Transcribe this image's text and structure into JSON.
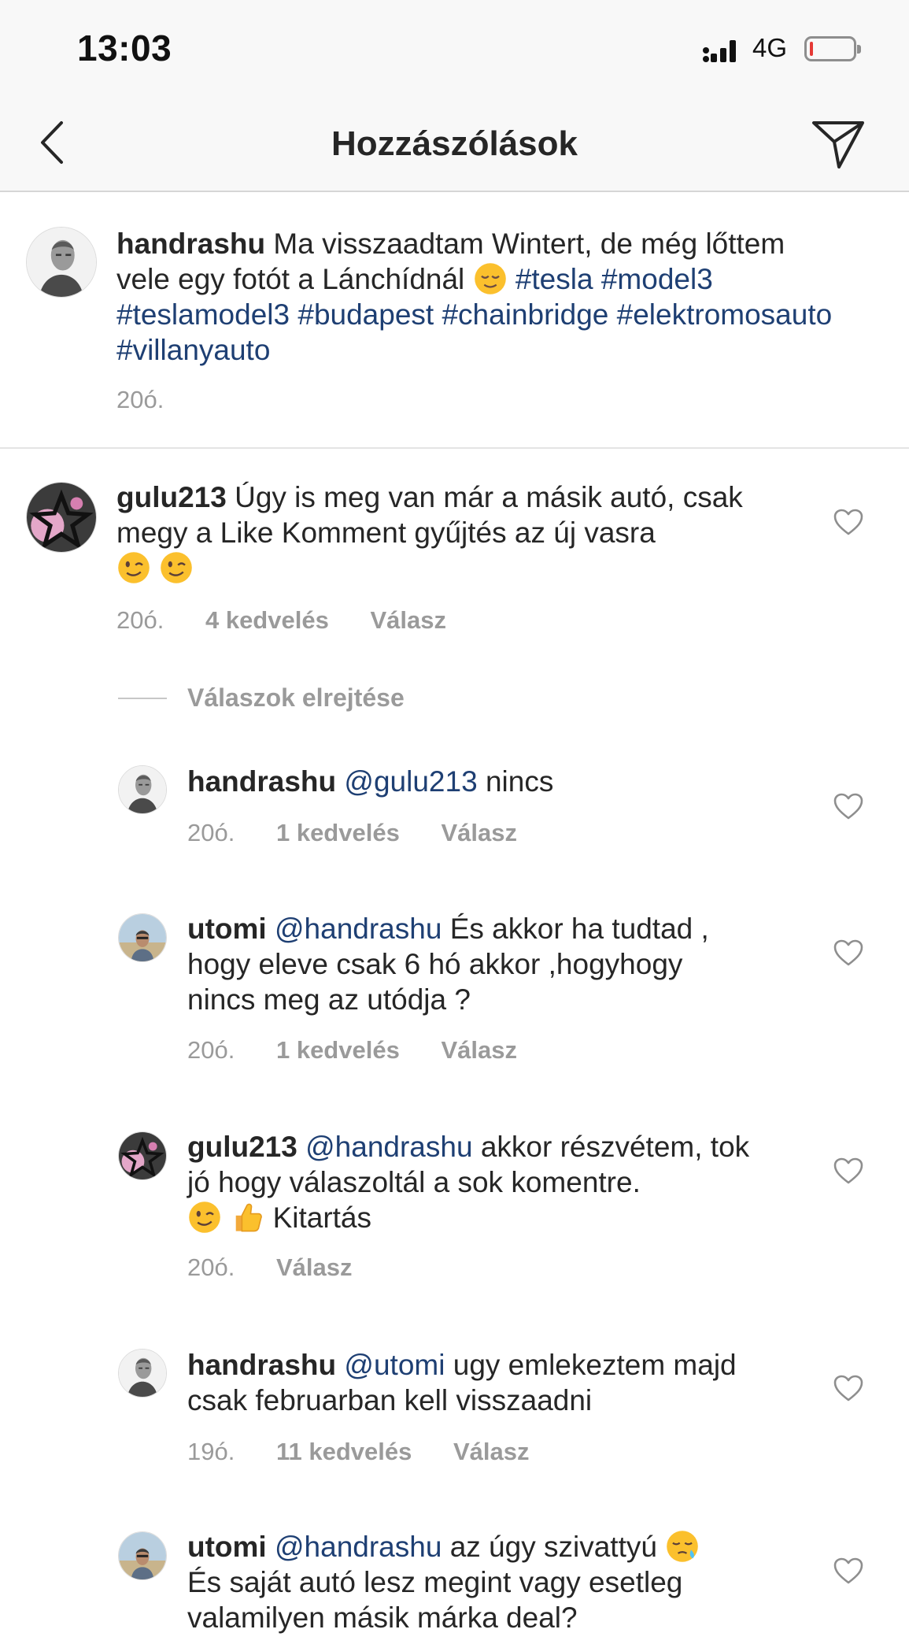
{
  "status_bar": {
    "time": "13:03",
    "network": "4G"
  },
  "header": {
    "title": "Hozzászólások"
  },
  "caption": {
    "username": "handrashu",
    "text": "Ma visszaadtam Wintert, de még lőttem vele egy fotót a Lánchídnál",
    "hashtags": [
      "#tesla",
      "#model3",
      "#teslamodel3",
      "#budapest",
      "#chainbridge",
      "#elektromosauto",
      "#villanyauto"
    ],
    "time": "20ó."
  },
  "comment": {
    "username": "gulu213",
    "text": "Úgy is meg van már a másik autó, csak megy a Like Komment gyűjtés az új vasra",
    "time": "20ó.",
    "likes": "4 kedvelés",
    "reply": "Válasz"
  },
  "hide_replies": "Válaszok elrejtése",
  "replies": [
    {
      "username": "handrashu",
      "mention": "@gulu213",
      "text": "nincs",
      "time": "20ó.",
      "likes": "1 kedvelés",
      "reply": "Válasz"
    },
    {
      "username": "utomi",
      "mention": "@handrashu",
      "text": "És akkor ha tudtad , hogy eleve csak 6 hó akkor ,hogyhogy nincs meg az utódja ?",
      "time": "20ó.",
      "likes": "1 kedvelés",
      "reply": "Válasz"
    },
    {
      "username": "gulu213",
      "mention": "@handrashu",
      "text": "akkor részvétem, tok jó hogy válaszoltál a sok komentre.",
      "text_after": "Kitartás",
      "time": "20ó.",
      "reply": "Válasz"
    },
    {
      "username": "handrashu",
      "mention": "@utomi",
      "text": "ugy emlekeztem majd csak februarban kell visszaadni",
      "time": "19ó.",
      "likes": "11 kedvelés",
      "reply": "Válasz"
    },
    {
      "username": "utomi",
      "mention": "@handrashu",
      "text": "az úgy szivattyú",
      "text_after": "És saját autó lesz megint vagy esetleg valamilyen másik márka deal?"
    }
  ],
  "icons": {
    "back": "chevron-left-icon",
    "send": "paper-plane-icon",
    "like": "heart-outline-icon",
    "emojis": [
      "relieved-face",
      "winking-face",
      "thumbs-up",
      "sleepy-face"
    ]
  },
  "colors": {
    "hashtag": "#1e3f73",
    "meta": "#9a9a9a",
    "text": "#262626",
    "bar": "#f8f8f8"
  }
}
